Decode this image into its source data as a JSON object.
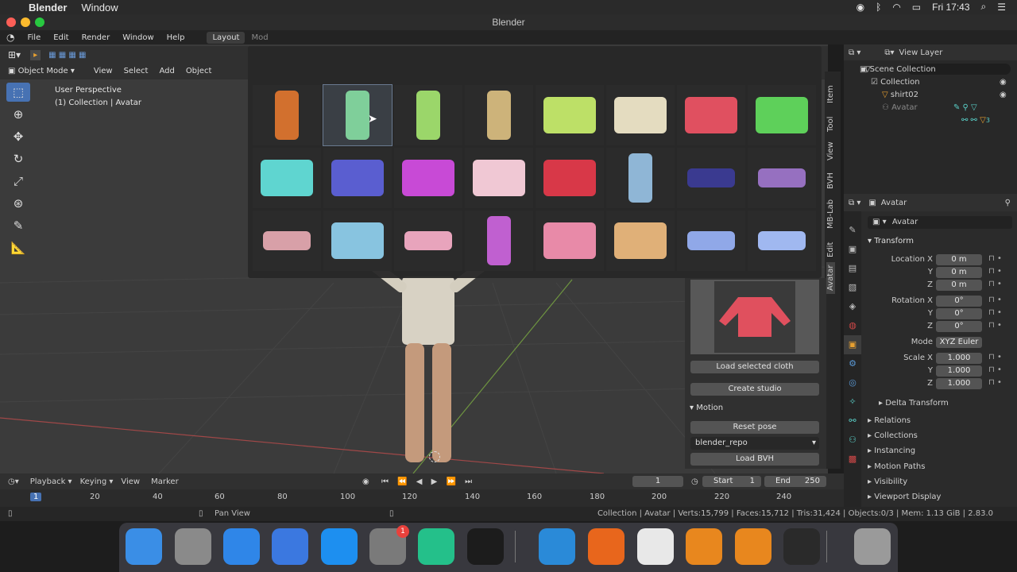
{
  "menubar": {
    "apple": "",
    "app": "Blender",
    "window": "Window",
    "clock": "Fri 17:43"
  },
  "window_title": "Blender",
  "topmenu": {
    "items": [
      "File",
      "Edit",
      "Render",
      "Window",
      "Help"
    ],
    "workspace": "Layout",
    "workspace2": "Mod"
  },
  "viewport": {
    "mode": "Object Mode",
    "menus": [
      "View",
      "Select",
      "Add",
      "Object"
    ],
    "overlay_line1": "User Perspective",
    "overlay_line2": "(1) Collection | Avatar"
  },
  "popup": {
    "thumbnails": [
      {
        "name": "orange-pants",
        "color": "#d2702e"
      },
      {
        "name": "mint-pants",
        "color": "#7fcf9a"
      },
      {
        "name": "lime-leggings",
        "color": "#9bd66a"
      },
      {
        "name": "beige-pants",
        "color": "#cdb37a"
      },
      {
        "name": "lime-shorts",
        "color": "#bde067"
      },
      {
        "name": "cream-sweater",
        "color": "#e4dcc0"
      },
      {
        "name": "red-sweater",
        "color": "#e05060"
      },
      {
        "name": "green-tank",
        "color": "#5ed05a"
      },
      {
        "name": "cyan-tank",
        "color": "#5fd5d0"
      },
      {
        "name": "blue-shirt",
        "color": "#5a5ed0"
      },
      {
        "name": "magenta-top",
        "color": "#c84ad6"
      },
      {
        "name": "pink-tee",
        "color": "#f0c8d4"
      },
      {
        "name": "red-cardigan",
        "color": "#d83848"
      },
      {
        "name": "blue-jeans",
        "color": "#8fb6d6"
      },
      {
        "name": "navy-shoes",
        "color": "#3a3a90"
      },
      {
        "name": "purple-socks",
        "color": "#9670c0"
      },
      {
        "name": "pink-shoes",
        "color": "#d8a0a8"
      },
      {
        "name": "blue-skirt",
        "color": "#88c4e0"
      },
      {
        "name": "pink-briefs",
        "color": "#e8a4bc"
      },
      {
        "name": "purple-suit",
        "color": "#c060d0"
      },
      {
        "name": "pink-shorts",
        "color": "#e88aa8"
      },
      {
        "name": "tan-shorts",
        "color": "#e0b078"
      },
      {
        "name": "blue-briefs",
        "color": "#90a8e8"
      },
      {
        "name": "blue-bra",
        "color": "#a0b8f0"
      }
    ]
  },
  "vtabs": [
    "Item",
    "Tool",
    "View",
    "BVH",
    "MB-Lab",
    "Edit",
    "Avatar"
  ],
  "npanel": {
    "load_cloth": "Load selected cloth",
    "create_studio": "Create studio",
    "motion_title": "Motion",
    "reset_pose": "Reset pose",
    "repo_value": "blender_repo",
    "load_bvh": "Load BVH"
  },
  "outliner": {
    "view_layer": "View Layer",
    "scene_collection": "Scene Collection",
    "collection": "Collection",
    "shirt": "shirt02",
    "avatar": "Avatar",
    "badge": "3"
  },
  "properties": {
    "object_name_header": "Avatar",
    "object_name_field": "Avatar",
    "transform_title": "Transform",
    "rows": [
      {
        "label": "Location X",
        "value": "0 m"
      },
      {
        "label": "Y",
        "value": "0 m"
      },
      {
        "label": "Z",
        "value": "0 m"
      },
      {
        "label": "Rotation X",
        "value": "0°"
      },
      {
        "label": "Y",
        "value": "0°"
      },
      {
        "label": "Z",
        "value": "0°"
      },
      {
        "label": "Mode",
        "value": "XYZ Euler"
      },
      {
        "label": "Scale X",
        "value": "1.000"
      },
      {
        "label": "Y",
        "value": "1.000"
      },
      {
        "label": "Z",
        "value": "1.000"
      }
    ],
    "delta": "Delta Transform",
    "sections": [
      "Relations",
      "Collections",
      "Instancing",
      "Motion Paths",
      "Visibility",
      "Viewport Display"
    ]
  },
  "timeline": {
    "menus": [
      "Playback",
      "Keying",
      "View",
      "Marker"
    ],
    "current_frame": "1",
    "start_label": "Start",
    "start": "1",
    "end_label": "End",
    "end": "250",
    "ticks": [
      "1",
      "20",
      "40",
      "60",
      "80",
      "100",
      "120",
      "140",
      "160",
      "180",
      "200",
      "220",
      "240"
    ]
  },
  "statusbar": {
    "left": "Pan View",
    "right": "Collection | Avatar | Verts:15,799 | Faces:15,712 | Tris:31,424 | Objects:0/3 | Mem: 1.13 GiB | 2.83.0"
  },
  "dock": {
    "apps": [
      {
        "name": "finder",
        "color": "#3a8ee6"
      },
      {
        "name": "launchpad",
        "color": "#8a8a8a"
      },
      {
        "name": "safari",
        "color": "#2f86e8"
      },
      {
        "name": "keynote",
        "color": "#3b78e0"
      },
      {
        "name": "app-store",
        "color": "#1d8ff0"
      },
      {
        "name": "system-preferences",
        "color": "#7a7a7a"
      },
      {
        "name": "pycharm",
        "color": "#24c08a"
      },
      {
        "name": "terminal",
        "color": "#1c1c1c"
      },
      {
        "name": "vscode",
        "color": "#2a8ad8"
      },
      {
        "name": "firefox",
        "color": "#e8661c"
      },
      {
        "name": "slack",
        "color": "#e8e8e8"
      },
      {
        "name": "blender",
        "color": "#e8871e"
      },
      {
        "name": "blender-2",
        "color": "#e8871e"
      },
      {
        "name": "quicktime",
        "color": "#2a2a2a"
      },
      {
        "name": "trash",
        "color": "#9a9a9a"
      }
    ],
    "badge": "1"
  }
}
